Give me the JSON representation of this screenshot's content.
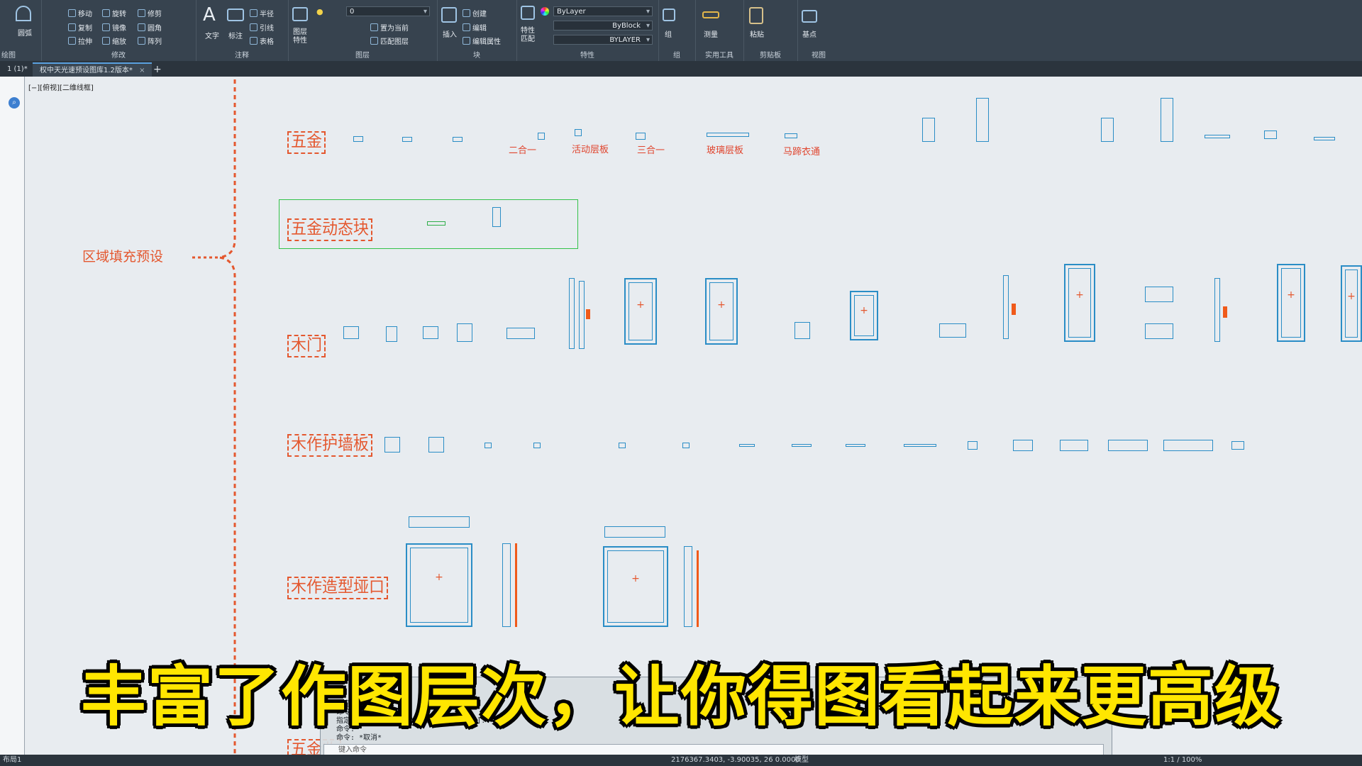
{
  "ribbon": {
    "modify": {
      "move": "移动",
      "rotate": "旋转",
      "trim": "修剪",
      "copy": "复制",
      "mirror": "镜像",
      "fillet": "圆角",
      "stretch": "拉伸",
      "scale": "缩放",
      "array": "阵列",
      "title": "修改"
    },
    "draw": {
      "arc": "圆弧",
      "title": "绘图"
    },
    "annotation": {
      "text": "文字",
      "dim": "标注",
      "radius": "半径",
      "leader": "引线",
      "table": "表格",
      "title": "注释"
    },
    "layers": {
      "layer_props": "图层特性",
      "current_layer": "0",
      "set_current": "置为当前",
      "match_layer": "匹配图层",
      "title": "图层"
    },
    "block": {
      "insert": "插入",
      "create": "创建",
      "edit": "编辑",
      "edit_attr": "编辑属性",
      "title": "块"
    },
    "properties": {
      "match": "特性匹配",
      "color": "ByLayer",
      "linetype": "ByBlock",
      "lineweight": "BYLAYER",
      "title": "特性"
    },
    "group": {
      "title": "组",
      "label": "组"
    },
    "utilities": {
      "measure": "测量",
      "title": "实用工具"
    },
    "clipboard": {
      "paste": "粘贴",
      "title": "剪贴板"
    },
    "view": {
      "base": "基点",
      "title": "视图"
    }
  },
  "tabs": [
    {
      "label": "1 (1)*"
    },
    {
      "label": "权中天光速预设图库1.2版本*"
    }
  ],
  "viewport_label": "[−][俯视][二维线框]",
  "mindmap": {
    "root": "区域填充预设",
    "categories": [
      "五金",
      "五金动态块",
      "木门",
      "木作护墙板",
      "木作造型垭口",
      "五金收"
    ]
  },
  "hardware_labels": [
    "二合一",
    "活动层板",
    "三合一",
    "玻璃层板",
    "马蹄衣通"
  ],
  "command_window": {
    "lines": [
      "指定点或",
      "命令:",
      "指定点位置或 [基点(B)/放弃(U)/退出(X)]:",
      "命令:",
      "命令: *取消*"
    ],
    "input_placeholder": "键入命令"
  },
  "subtitle": "丰富了作图层次，让你得图看起来更高级",
  "status": {
    "left": "布局1",
    "coords": "2176367.3403, -3.90035, 26 0.0000",
    "model": "模型",
    "scale": "1:1 / 100%"
  }
}
